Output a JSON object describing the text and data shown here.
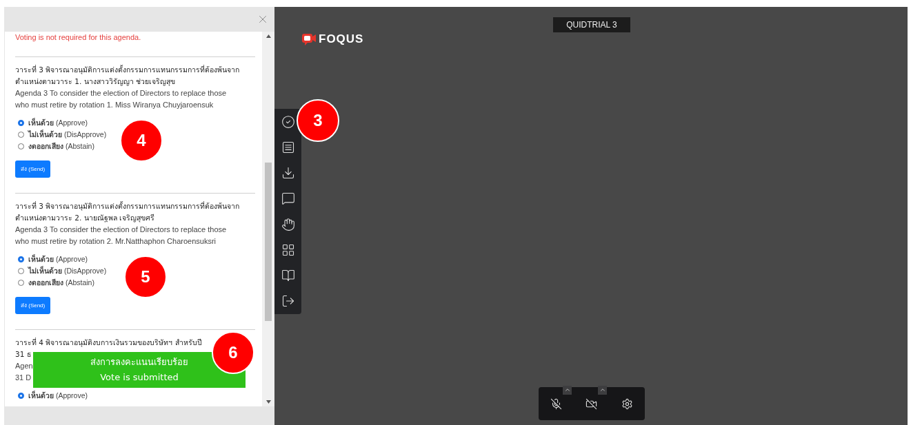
{
  "vote_panel": {
    "notice": "Voting is not required for this agenda.",
    "agendas": [
      {
        "thai_heading": "วาระที่ 3 พิจารณาอนุมัติการแต่งตั้งกรรมการแทนกรรมการที่ต้องพ้นจาก\nตำแหน่งตามวาระ 1. นางสาววิรัญญา ช่วยเจริญสุข",
        "english_heading": "Agenda 3 To consider the election of Directors to replace those\nwho must retire by rotation 1. Miss Wiranya Chuyjaroensuk",
        "options": [
          {
            "label": "**เห็นด้วย** (Approve)",
            "selected": true
          },
          {
            "label": "**ไม่เห็นด้วย** (DisApprove)",
            "selected": false
          },
          {
            "label": "**งดออกเสียง** (Abstain)",
            "selected": false
          }
        ],
        "send_label": "ส่ง (Send)",
        "callout": "4"
      },
      {
        "thai_heading": "วาระที่ 3 พิจารณาอนุมัติการแต่งตั้งกรรมการแทนกรรมการที่ต้องพ้นจาก\nตำแหน่งตามวาระ 2. นายณัฐพล เจริญสุขศรี",
        "english_heading": "Agenda 3 To consider the election of Directors to replace those\nwho must retire by rotation 2. Mr.Natthaphon Charoensuksri",
        "options": [
          {
            "label": "**เห็นด้วย** (Approve)",
            "selected": true
          },
          {
            "label": "**ไม่เห็นด้วย** (DisApprove)",
            "selected": false
          },
          {
            "label": "**งดออกเสียง** (Abstain)",
            "selected": false
          }
        ],
        "send_label": "ส่ง (Send)",
        "callout": "5"
      },
      {
        "thai_heading": "วาระที่ 4 พิจารณาอนุมัติงบการเงินรวมของบริษัทฯ สำหรับปี\n31 ธ",
        "english_heading": "Agen\n31 D",
        "options": [
          {
            "label": "**เห็นด้วย** (Approve)",
            "selected": true
          }
        ]
      }
    ],
    "toast": {
      "lines": [
        "ส่งการลงคะแนนเรียบร้อย",
        "Vote is submitted"
      ],
      "callout": "6"
    }
  },
  "meeting": {
    "logo": "FOQUS",
    "room_title": "QUIDTRIAL 3",
    "toolbar_callout": "3"
  }
}
